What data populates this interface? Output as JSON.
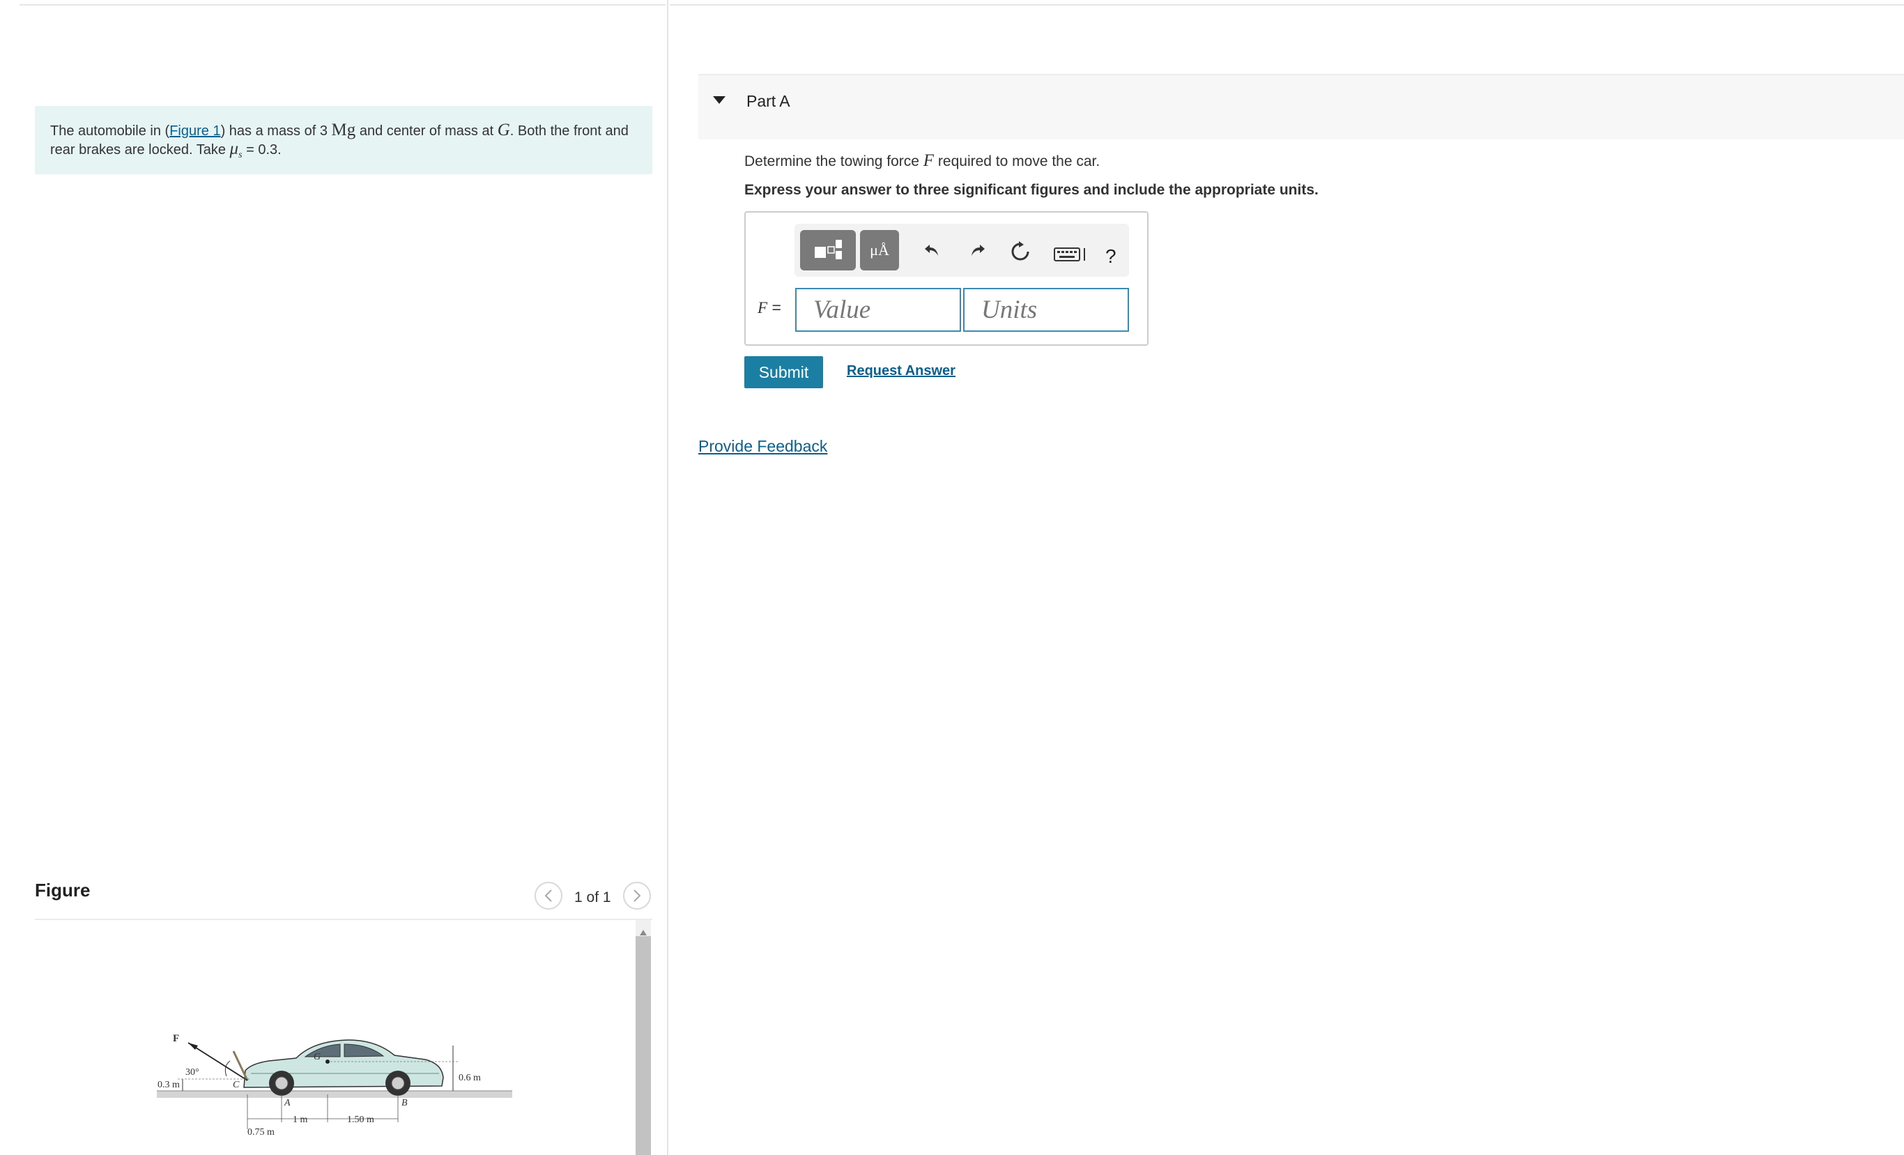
{
  "problem": {
    "text_1": "The automobile in (",
    "figure_link": "Figure 1",
    "text_2": ") has a mass of 3 ",
    "unit_mg": "Mg",
    "text_3": " and center of mass at ",
    "symbol_g": "G",
    "text_4": ". Both the front and rear brakes are locked. Take ",
    "symbol_mu": "μ",
    "symbol_mu_sub": "s",
    "text_5": " = 0.3."
  },
  "figure_panel": {
    "title": "Figure",
    "pagination": "1 of 1",
    "prev_icon": "chevron-left-icon",
    "next_icon": "chevron-right-icon",
    "diagram_labels": {
      "force": "F",
      "angle": "30°",
      "height_c": "0.3 m",
      "point_c": "C",
      "point_a": "A",
      "point_b": "B",
      "point_g": "G",
      "height_g": "0.6 m",
      "dist_ca": "0.75 m",
      "dist_ag": "1 m",
      "dist_gb": "1.50 m"
    }
  },
  "part_a": {
    "title": "Part A",
    "question_1": "Determine the towing force ",
    "question_symbol": "F",
    "question_2": " required to move the car.",
    "instruction": "Express your answer to three significant figures and include the appropriate units.",
    "variable_label": "F",
    "equals": " =",
    "value_placeholder": "Value",
    "units_placeholder": "Units",
    "toolbar": {
      "units_glyph": "μÅ",
      "undo_icon": "undo-icon",
      "redo_icon": "redo-icon",
      "reset_icon": "reset-icon",
      "keyboard_icon": "keyboard-icon",
      "help_label": "?"
    },
    "submit_label": "Submit",
    "request_answer_label": "Request Answer"
  },
  "feedback_label": "Provide Feedback",
  "colors": {
    "accent": "#1a7fa3",
    "link": "#0b5f8c",
    "intro_bg": "#e6f4f4",
    "input_border": "#3b8ab4"
  }
}
